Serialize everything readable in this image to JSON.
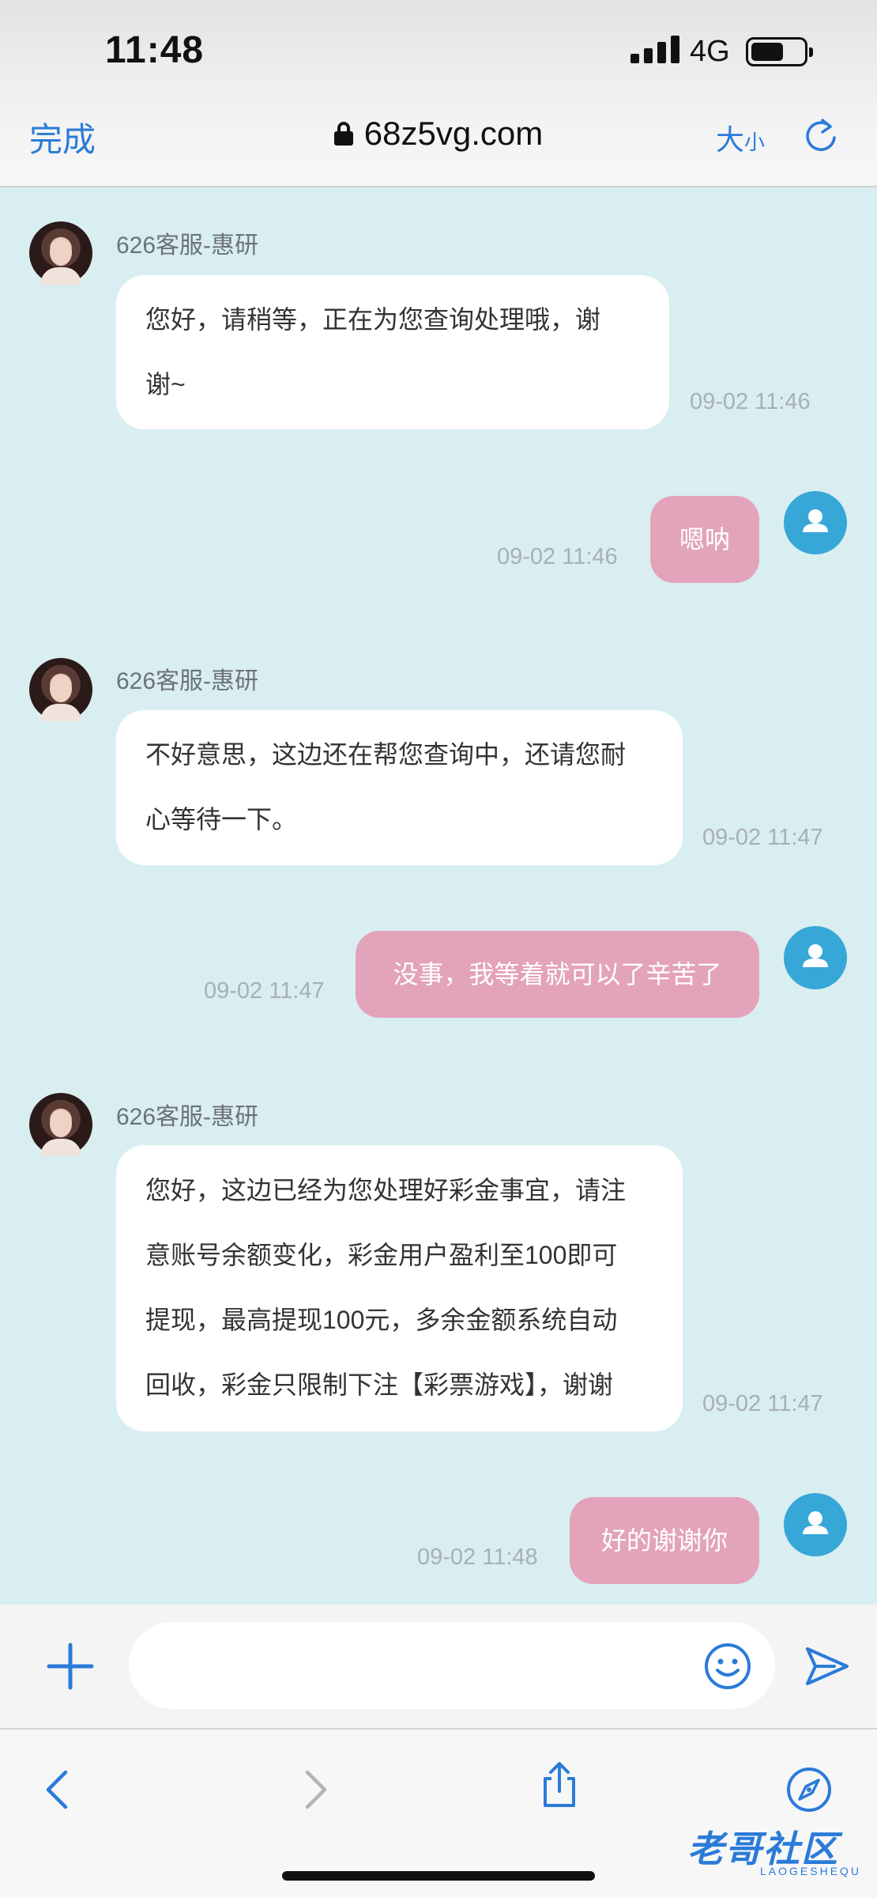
{
  "status_bar": {
    "time": "11:48",
    "network": "4G",
    "battery_level": 0.6
  },
  "browser": {
    "done_label": "完成",
    "url": "68z5vg.com",
    "text_size_big": "大",
    "text_size_small": "小"
  },
  "messages": [
    {
      "direction": "in",
      "sender": "626客服-惠研",
      "lines": [
        "您好，请稍等，正在为您查询处理哦，谢",
        "谢~"
      ],
      "time": "09-02 11:46"
    },
    {
      "direction": "out",
      "text": "嗯呐",
      "time": "09-02 11:46"
    },
    {
      "direction": "in",
      "sender": "626客服-惠研",
      "lines": [
        "不好意思，这边还在帮您查询中，还请您耐",
        "心等待一下。"
      ],
      "time": "09-02 11:47"
    },
    {
      "direction": "out",
      "text": "没事，我等着就可以了辛苦了",
      "time": "09-02 11:47"
    },
    {
      "direction": "in",
      "sender": "626客服-惠研",
      "lines": [
        "您好，这边已经为您处理好彩金事宜，请注",
        "意账号余额变化，彩金用户盈利至100即可",
        "提现，最高提现100元，多余金额系统自动",
        "回收，彩金只限制下注【彩票游戏】，谢谢"
      ],
      "time": "09-02 11:47"
    },
    {
      "direction": "out",
      "text": "好的谢谢你",
      "time": "09-02 11:48"
    }
  ],
  "input": {
    "placeholder": ""
  },
  "watermark": {
    "main": "老哥社区",
    "sub": "LAOGESHEQU"
  },
  "colors": {
    "accent": "#2b7bd8",
    "chat_bg": "#d9eef0",
    "out_bubble": "#e3a3bb",
    "user_avatar": "#37a7d8"
  }
}
